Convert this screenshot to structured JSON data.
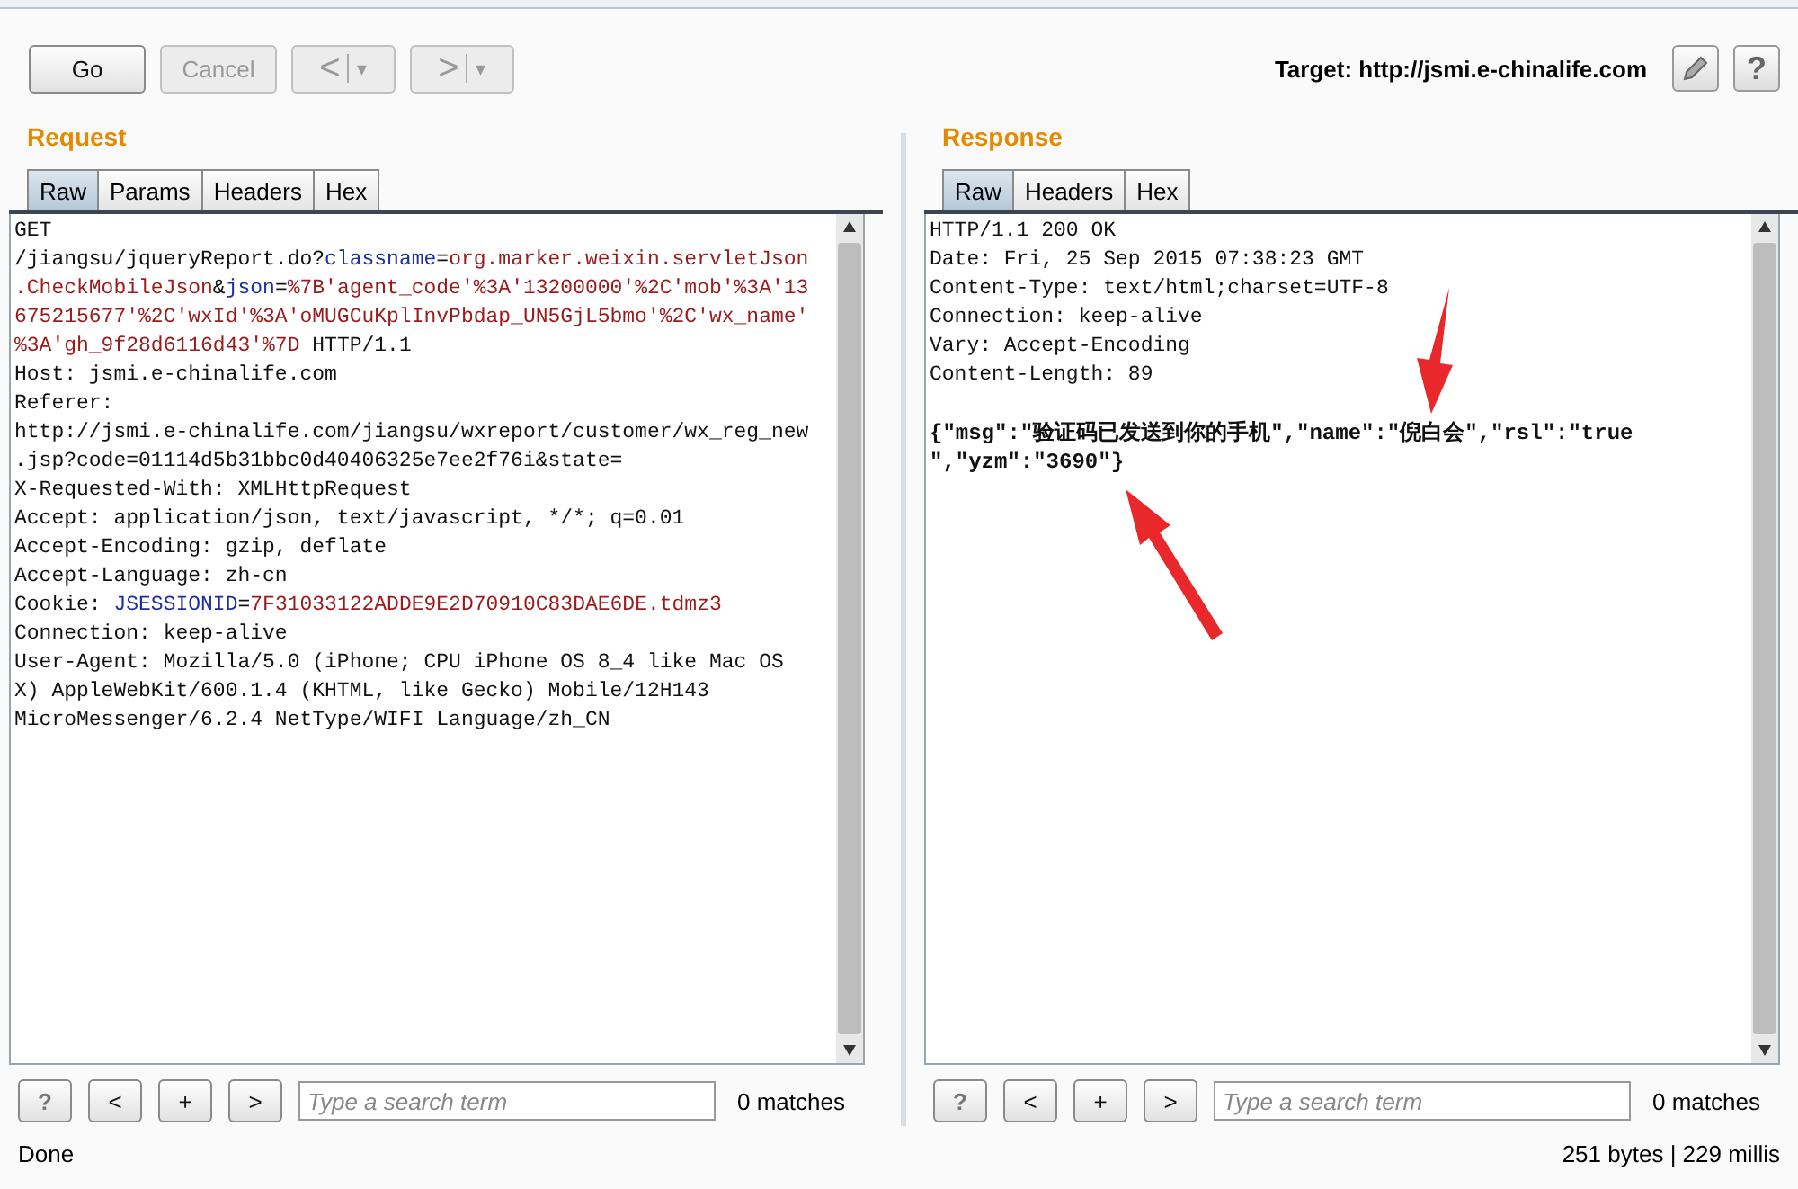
{
  "toolbar": {
    "buttons": [
      {
        "label": "Go",
        "disabled": false
      },
      {
        "label": "Cancel",
        "disabled": true
      }
    ],
    "history": [
      {
        "glyph": "<",
        "dropdown": "▾",
        "disabled": true
      },
      {
        "glyph": ">",
        "dropdown": "▾",
        "disabled": true
      }
    ],
    "target": "Target: http://jsmi.e-chinalife.com",
    "help": "?"
  },
  "panels": [
    {
      "title": "Request",
      "tabs": [
        {
          "label": "Raw",
          "selected": true
        },
        {
          "label": "Params",
          "selected": false
        },
        {
          "label": "Headers",
          "selected": false
        },
        {
          "label": "Hex",
          "selected": false
        }
      ],
      "lines": [
        {
          "kind": "plain",
          "segments": [
            {
              "text": "GET",
              "kind": "plain"
            }
          ]
        },
        {
          "kind": "plain",
          "segments": [
            {
              "text": "/jiangsu/jqueryReport.do?",
              "kind": "plain"
            },
            {
              "text": "classname",
              "kind": "key"
            },
            {
              "text": "=",
              "kind": "plain"
            },
            {
              "text": "org.marker.weixin.servletJson",
              "kind": "value"
            }
          ]
        },
        {
          "kind": "plain",
          "segments": [
            {
              "text": ".CheckMobileJson",
              "kind": "value"
            },
            {
              "text": "&",
              "kind": "plain"
            },
            {
              "text": "json",
              "kind": "key"
            },
            {
              "text": "=",
              "kind": "plain"
            },
            {
              "text": "%7B'agent_code'%3A'13200000'%2C'mob'%3A'13",
              "kind": "value"
            }
          ]
        },
        {
          "kind": "plain",
          "segments": [
            {
              "text": "675215677'%2C'wxId'%3A'oMUGCuKplInvPbdap_UN5GjL5bmo'%2C'wx_name'",
              "kind": "value"
            }
          ]
        },
        {
          "kind": "plain",
          "segments": [
            {
              "text": "%3A'gh_9f28d6116d43'%7D",
              "kind": "value"
            },
            {
              "text": " HTTP/1.1",
              "kind": "plain"
            }
          ]
        },
        {
          "kind": "plain",
          "segments": [
            {
              "text": "Host: jsmi.e-chinalife.com",
              "kind": "plain"
            }
          ]
        },
        {
          "kind": "plain",
          "segments": [
            {
              "text": "Referer:",
              "kind": "plain"
            }
          ]
        },
        {
          "kind": "plain",
          "segments": [
            {
              "text": "http://jsmi.e-chinalife.com/jiangsu/wxreport/customer/wx_reg_new",
              "kind": "plain"
            }
          ]
        },
        {
          "kind": "plain",
          "segments": [
            {
              "text": ".jsp?code=01114d5b31bbc0d40406325e7ee2f76i&state=",
              "kind": "plain"
            }
          ]
        },
        {
          "kind": "plain",
          "segments": [
            {
              "text": "X-Requested-With: XMLHttpRequest",
              "kind": "plain"
            }
          ]
        },
        {
          "kind": "plain",
          "segments": [
            {
              "text": "Accept: application/json, text/javascript, */*; q=0.01",
              "kind": "plain"
            }
          ]
        },
        {
          "kind": "plain",
          "segments": [
            {
              "text": "Accept-Encoding: gzip, deflate",
              "kind": "plain"
            }
          ]
        },
        {
          "kind": "plain",
          "segments": [
            {
              "text": "Accept-Language: zh-cn",
              "kind": "plain"
            }
          ]
        },
        {
          "kind": "plain",
          "segments": [
            {
              "text": "Cookie: ",
              "kind": "plain"
            },
            {
              "text": "JSESSIONID",
              "kind": "key"
            },
            {
              "text": "=",
              "kind": "plain"
            },
            {
              "text": "7F31033122ADDE9E2D70910C83DAE6DE.tdmz3",
              "kind": "value"
            }
          ]
        },
        {
          "kind": "plain",
          "segments": [
            {
              "text": "Connection: keep-alive",
              "kind": "plain"
            }
          ]
        },
        {
          "kind": "plain",
          "segments": [
            {
              "text": "User-Agent: Mozilla/5.0 (iPhone; CPU iPhone OS 8_4 like Mac OS",
              "kind": "plain"
            }
          ]
        },
        {
          "kind": "plain",
          "segments": [
            {
              "text": "X) AppleWebKit/600.1.4 (KHTML, like Gecko) Mobile/12H143",
              "kind": "plain"
            }
          ]
        },
        {
          "kind": "plain",
          "segments": [
            {
              "text": "MicroMessenger/6.2.4 NetType/WIFI Language/zh_CN",
              "kind": "plain"
            }
          ]
        }
      ],
      "search": {
        "placeholder": "Type a search term",
        "buttons": [
          "?",
          "<",
          "+",
          ">"
        ],
        "matches": "0 matches"
      }
    },
    {
      "title": "Response",
      "tabs": [
        {
          "label": "Raw",
          "selected": true
        },
        {
          "label": "Headers",
          "selected": false
        },
        {
          "label": "Hex",
          "selected": false
        }
      ],
      "lines": [
        {
          "kind": "plain",
          "segments": [
            {
              "text": "HTTP/1.1 200 OK",
              "kind": "plain"
            }
          ]
        },
        {
          "kind": "plain",
          "segments": [
            {
              "text": "Date: Fri, 25 Sep 2015 07:38:23 GMT",
              "kind": "plain"
            }
          ]
        },
        {
          "kind": "plain",
          "segments": [
            {
              "text": "Content-Type: text/html;charset=UTF-8",
              "kind": "plain"
            }
          ]
        },
        {
          "kind": "plain",
          "segments": [
            {
              "text": "Connection: keep-alive",
              "kind": "plain"
            }
          ]
        },
        {
          "kind": "plain",
          "segments": [
            {
              "text": "Vary: Accept-Encoding",
              "kind": "plain"
            }
          ]
        },
        {
          "kind": "plain",
          "segments": [
            {
              "text": "Content-Length: 89",
              "kind": "plain"
            }
          ]
        },
        {
          "kind": "blank"
        },
        {
          "kind": "body",
          "segments": [
            {
              "text": "{\"msg\":\"验证码已发送到你的手机\",\"name\":\"倪白会\",\"rsl\":\"true",
              "kind": "plain"
            }
          ]
        },
        {
          "kind": "body",
          "segments": [
            {
              "text": "\",\"yzm\":\"3690\"}",
              "kind": "plain"
            }
          ]
        }
      ],
      "search": {
        "placeholder": "Type a search term",
        "buttons": [
          "?",
          "<",
          "+",
          ">"
        ],
        "matches": "0 matches"
      }
    }
  ],
  "status_bar": {
    "left": "Done",
    "right": "251 bytes | 229 millis"
  }
}
